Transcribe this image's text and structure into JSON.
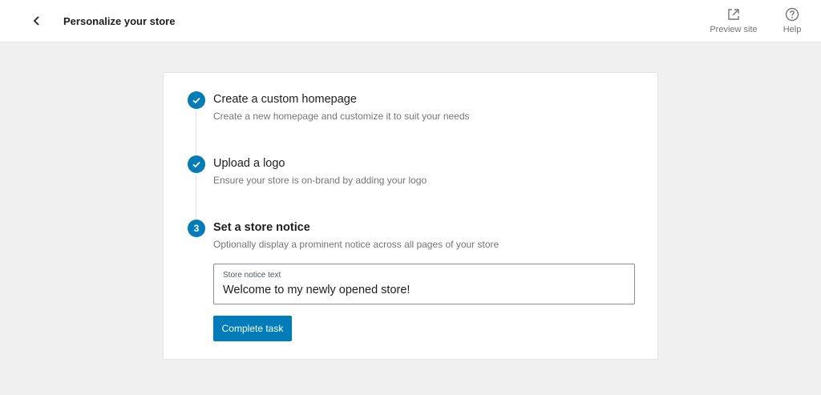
{
  "header": {
    "title": "Personalize your store",
    "back_icon": "chevron-left-icon",
    "actions": [
      {
        "label": "Preview site",
        "icon": "external-link-icon"
      },
      {
        "label": "Help",
        "icon": "help-circle-icon"
      }
    ]
  },
  "steps": [
    {
      "title": "Create a custom homepage",
      "description": "Create a new homepage and customize it to suit your needs",
      "status": "completed",
      "indicator_icon": "check-icon"
    },
    {
      "title": "Upload a logo",
      "description": "Ensure your store is on-brand by adding your logo",
      "status": "completed",
      "indicator_icon": "check-icon"
    },
    {
      "number": "3",
      "title": "Set a store notice",
      "description": "Optionally display a prominent notice across all pages of your store",
      "status": "active"
    }
  ],
  "store_notice": {
    "label": "Store notice text",
    "value": "Welcome to my newly opened store!"
  },
  "complete_button": {
    "label": "Complete task"
  },
  "colors": {
    "accent": "#007cba",
    "page_background": "#f0f0f1",
    "card_background": "#ffffff",
    "muted_text": "#757575"
  }
}
